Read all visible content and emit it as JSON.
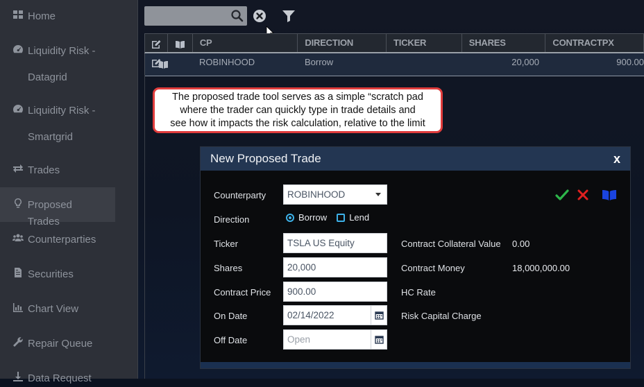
{
  "sidebar": {
    "items": [
      {
        "label": "Home",
        "icon": "grid-icon"
      },
      {
        "label": "Liquidity Risk - Datagrid",
        "icon": "gauge-icon"
      },
      {
        "label": "Liquidity Risk - Smartgrid",
        "icon": "gauge-icon"
      },
      {
        "label": "Trades",
        "icon": "exchange-icon"
      },
      {
        "label": "Proposed Trades",
        "icon": "lightbulb-icon"
      },
      {
        "label": "Counterparties",
        "icon": "users-icon"
      },
      {
        "label": "Securities",
        "icon": "file-icon"
      },
      {
        "label": "Chart View",
        "icon": "chart-icon"
      },
      {
        "label": "Repair Queue",
        "icon": "wrench-icon"
      },
      {
        "label": "Data Request",
        "icon": "download-icon"
      }
    ],
    "active_index": 4
  },
  "grid": {
    "columns": [
      "",
      "",
      "CP",
      "DIRECTION",
      "TICKER",
      "SHARES",
      "CONTRACTPX"
    ],
    "rows": [
      {
        "cp": "ROBINHOOD",
        "direction": "Borrow",
        "ticker": "",
        "shares": "20,000",
        "contractpx": "900.00"
      }
    ]
  },
  "callout": {
    "lines": [
      "The proposed trade tool serves as a simple “scratch pad",
      "where the trader can quickly type in trade details  and",
      "see how it impacts the risk calculation, relative to the limit"
    ]
  },
  "dialog": {
    "title": "New Proposed Trade",
    "close_label": "x",
    "counterparty_label": "Counterparty",
    "counterparty_value": "ROBINHOOD",
    "direction_label": "Direction",
    "direction_options": [
      "Borrow",
      "Lend"
    ],
    "direction_selected": "Borrow",
    "ticker_label": "Ticker",
    "ticker_value": "TSLA US Equity",
    "shares_label": "Shares",
    "shares_value": "20,000",
    "contract_price_label": "Contract Price",
    "contract_price_value": "900.00",
    "on_date_label": "On Date",
    "on_date_value": "02/14/2022",
    "off_date_label": "Off Date",
    "off_date_placeholder": "Open",
    "contract_collateral_label": "Contract Collateral Value",
    "contract_collateral_value": "0.00",
    "contract_money_label": "Contract Money",
    "contract_money_value": "18,000,000.00",
    "hc_rate_label": "HC Rate",
    "risk_capital_label": "Risk Capital Charge"
  },
  "colors": {
    "accent_blue": "#3db1e8",
    "confirm_green": "#2db64a",
    "cancel_red": "#e02020",
    "book_blue": "#1a44e0",
    "callout_border": "#e03c3c"
  }
}
